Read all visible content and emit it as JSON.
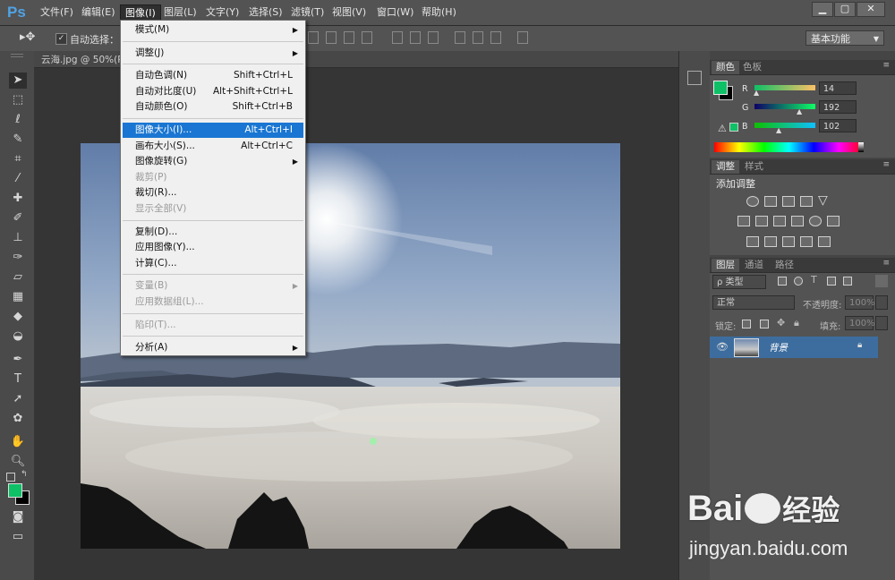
{
  "app": {
    "logo": "Ps"
  },
  "menubar": {
    "items": [
      "文件(F)",
      "编辑(E)",
      "图像(I)",
      "图层(L)",
      "文字(Y)",
      "选择(S)",
      "滤镜(T)",
      "视图(V)",
      "窗口(W)",
      "帮助(H)"
    ],
    "active_index": 2
  },
  "window_buttons": [
    "▁",
    "▢",
    "✕"
  ],
  "options_bar": {
    "auto_select_label": "自动选择：",
    "workspace": "基本功能"
  },
  "document": {
    "title": "云海.jpg @ 50%(R"
  },
  "image_menu": {
    "items": [
      {
        "label": "模式(M)",
        "shortcut": "",
        "submenu": true,
        "disabled": false
      },
      {
        "sep": true
      },
      {
        "label": "调整(J)",
        "shortcut": "",
        "submenu": true,
        "disabled": false
      },
      {
        "sep": true
      },
      {
        "label": "自动色调(N)",
        "shortcut": "Shift+Ctrl+L",
        "submenu": false,
        "disabled": false
      },
      {
        "label": "自动对比度(U)",
        "shortcut": "Alt+Shift+Ctrl+L",
        "submenu": false,
        "disabled": false
      },
      {
        "label": "自动颜色(O)",
        "shortcut": "Shift+Ctrl+B",
        "submenu": false,
        "disabled": false
      },
      {
        "sep": true
      },
      {
        "label": "图像大小(I)...",
        "shortcut": "Alt+Ctrl+I",
        "submenu": false,
        "disabled": false,
        "highlighted": true
      },
      {
        "label": "画布大小(S)...",
        "shortcut": "Alt+Ctrl+C",
        "submenu": false,
        "disabled": false
      },
      {
        "label": "图像旋转(G)",
        "shortcut": "",
        "submenu": true,
        "disabled": false
      },
      {
        "label": "裁剪(P)",
        "shortcut": "",
        "submenu": false,
        "disabled": true
      },
      {
        "label": "裁切(R)...",
        "shortcut": "",
        "submenu": false,
        "disabled": false
      },
      {
        "label": "显示全部(V)",
        "shortcut": "",
        "submenu": false,
        "disabled": true
      },
      {
        "sep": true
      },
      {
        "label": "复制(D)...",
        "shortcut": "",
        "submenu": false,
        "disabled": false
      },
      {
        "label": "应用图像(Y)...",
        "shortcut": "",
        "submenu": false,
        "disabled": false
      },
      {
        "label": "计算(C)...",
        "shortcut": "",
        "submenu": false,
        "disabled": false
      },
      {
        "sep": true
      },
      {
        "label": "变量(B)",
        "shortcut": "",
        "submenu": true,
        "disabled": true
      },
      {
        "label": "应用数据组(L)...",
        "shortcut": "",
        "submenu": false,
        "disabled": true
      },
      {
        "sep": true
      },
      {
        "label": "陷印(T)...",
        "shortcut": "",
        "submenu": false,
        "disabled": true
      },
      {
        "sep": true
      },
      {
        "label": "分析(A)",
        "shortcut": "",
        "submenu": true,
        "disabled": false
      }
    ]
  },
  "color_panel": {
    "tabs": [
      "颜色",
      "色板"
    ],
    "foreground": "#0ec066",
    "channels": [
      {
        "name": "R",
        "value": "14"
      },
      {
        "name": "G",
        "value": "192"
      },
      {
        "name": "B",
        "value": "102"
      }
    ]
  },
  "adjust_panel": {
    "tabs": [
      "调整",
      "样式"
    ],
    "add_label": "添加调整"
  },
  "layers_panel": {
    "tabs": [
      "图层",
      "通道",
      "路径"
    ],
    "filter": "ρ 类型",
    "blend_mode": "正常",
    "opacity_label": "不透明度:",
    "opacity_value": "100%",
    "lock_label": "锁定:",
    "fill_label": "填充:",
    "fill_value": "100%",
    "layer_name": "背景"
  },
  "watermark": {
    "logo_a": "Bai",
    "logo_b": "经验",
    "url": "jingyan.baidu.com"
  },
  "colors": {
    "accent": "#1a76d2",
    "foreground": "#0ec066"
  }
}
